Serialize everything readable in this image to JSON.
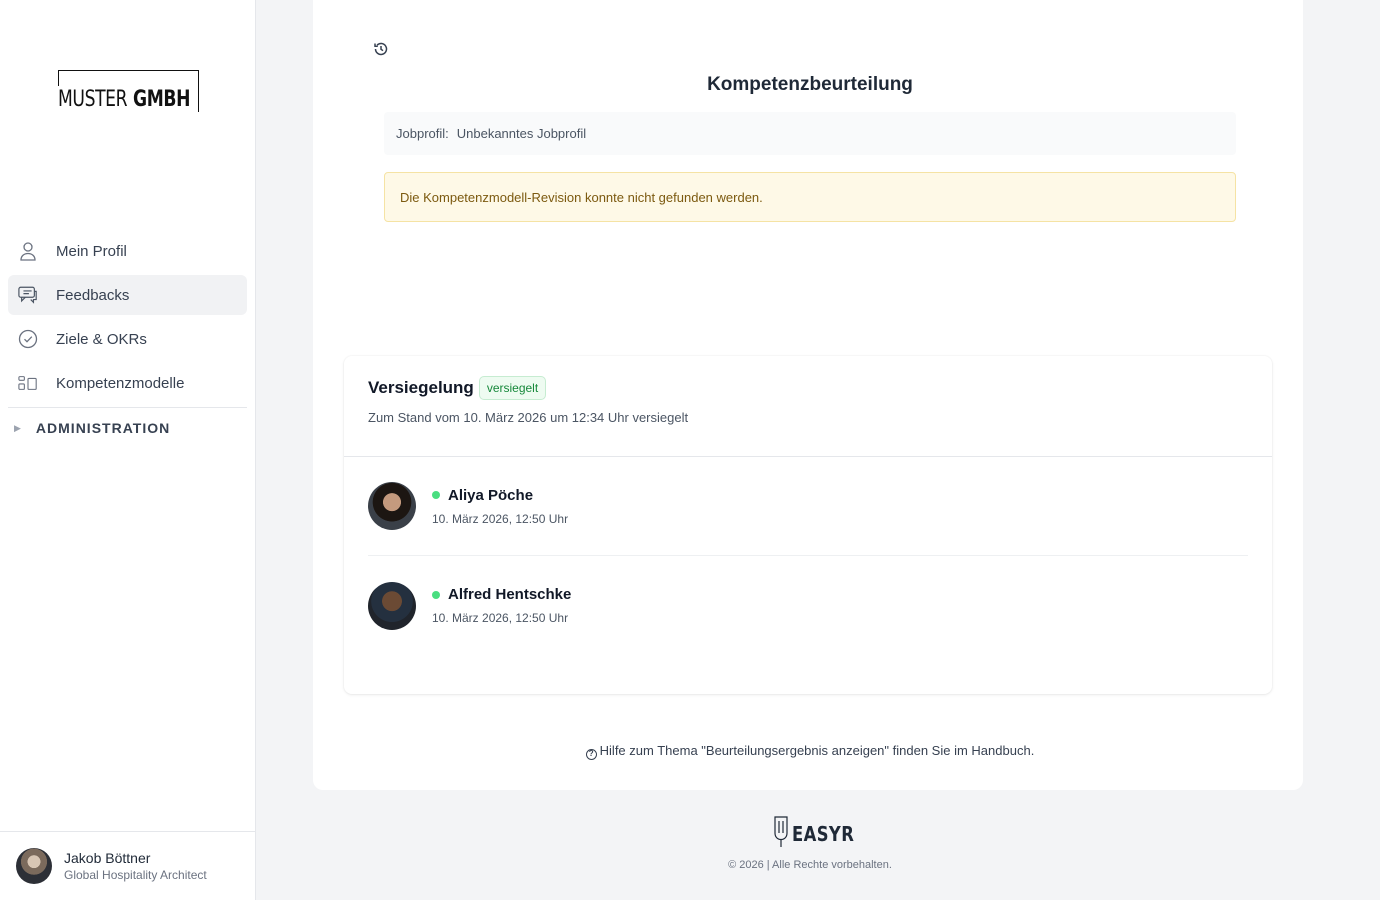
{
  "brand": {
    "logo_light": "MUSTER",
    "logo_bold": "GMBH"
  },
  "sidebar": {
    "items": [
      {
        "label": "Mein Profil",
        "icon": "user-icon"
      },
      {
        "label": "Feedbacks",
        "icon": "chat-icon",
        "active": true
      },
      {
        "label": "Ziele & OKRs",
        "icon": "check-circle-icon"
      },
      {
        "label": "Kompetenzmodelle",
        "icon": "models-icon"
      }
    ],
    "admin_label": "ADMINISTRATION"
  },
  "user": {
    "name": "Jakob Böttner",
    "role": "Global Hospitality Architect"
  },
  "main": {
    "title": "Kompetenzbeurteilung",
    "jobprofil_label": "Jobprofil:",
    "jobprofil_value": "Unbekanntes Jobprofil",
    "alert": "Die Kompetenzmodell-Revision konnte nicht gefunden werden."
  },
  "seal": {
    "title": "Versiegelung",
    "badge": "versiegelt",
    "subtitle": "Zum Stand vom 10. März 2026 um 12:34 Uhr versiegelt",
    "signers": [
      {
        "name": "Aliya Pöche",
        "date": "10. März 2026, 12:50 Uhr"
      },
      {
        "name": "Alfred Hentschke",
        "date": "10. März 2026, 12:50 Uhr"
      }
    ]
  },
  "help": {
    "prefix": "Hilfe zum Thema \"Beurteilungsergebnis anzeigen\" finden Sie im",
    "link": "Handbuch",
    "suffix": "."
  },
  "footer": {
    "logo": "EASYR",
    "copyright": "© 2026 | Alle Rechte vorbehalten."
  },
  "colors": {
    "accent_green": "#4ade80",
    "alert_bg": "#fef9e7",
    "badge_text": "#16883a"
  }
}
